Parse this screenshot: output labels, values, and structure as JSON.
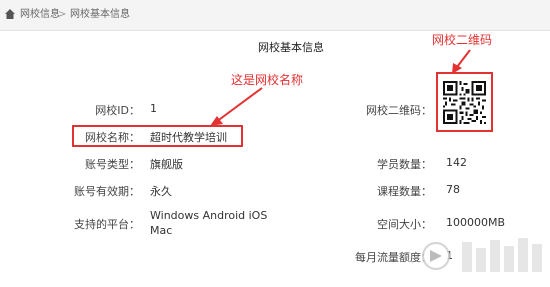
{
  "breadcrumb": {
    "home": "网校信息",
    "separator": ">",
    "current": "网校基本信息"
  },
  "page_title": "网校基本信息",
  "annotations": {
    "name_note": "这是网校名称",
    "qr_note": "网校二维码"
  },
  "fields": {
    "school_id": {
      "label": "网校ID：",
      "value": "1"
    },
    "school_name": {
      "label": "网校名称：",
      "value": "超时代教学培训"
    },
    "account_type": {
      "label": "账号类型：",
      "value": "旗舰版"
    },
    "account_validity": {
      "label": "账号有效期：",
      "value": "永久"
    },
    "platforms": {
      "label": "支持的平台：",
      "value_line1": "Windows Android iOS",
      "value_line2": "Mac"
    },
    "qr_code": {
      "label": "网校二维码："
    },
    "student_count": {
      "label": "学员数量：",
      "value": "142"
    },
    "course_count": {
      "label": "课程数量：",
      "value": "78"
    },
    "space_size": {
      "label": "空间大小：",
      "value": "100000MB"
    },
    "monthly_traffic": {
      "label": "每月流量额度：",
      "value": "1"
    }
  },
  "colors": {
    "annotation_red": "#e33232",
    "topbar_bg": "#f4f4f4"
  },
  "icons": {
    "home": "home-icon",
    "qr": "qr-code-icon"
  }
}
